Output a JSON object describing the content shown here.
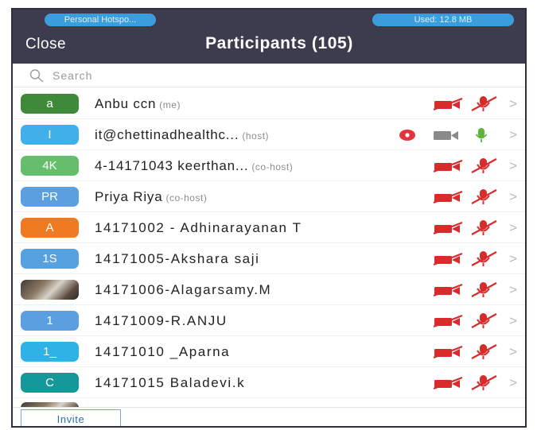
{
  "status_bar": {
    "hotspot_label": "Personal Hotspo...",
    "data_used": "Used: 12.8 MB"
  },
  "header": {
    "close_label": "Close",
    "title": "Participants (105)"
  },
  "search": {
    "placeholder": "Search"
  },
  "participants": [
    {
      "initials": "a",
      "avatar_color": "#3f8a3a",
      "name": "Anbu ccn",
      "role": "(me)",
      "video": "off",
      "mic": "muted"
    },
    {
      "initials": "I",
      "avatar_color": "#42b0e8",
      "name": "it@chettinadhealthc...",
      "role": "(host)",
      "video": "on",
      "mic": "on",
      "recording": true
    },
    {
      "initials": "4K",
      "avatar_color": "#66bd6b",
      "name": "4-14171043 keerthan...",
      "role": "(co-host)",
      "video": "off",
      "mic": "muted"
    },
    {
      "initials": "PR",
      "avatar_color": "#5b9fe0",
      "name": "Priya Riya",
      "role": "(co-host)",
      "video": "off",
      "mic": "muted"
    },
    {
      "initials": "A",
      "avatar_color": "#f07a22",
      "name": "14171002 - Adhinarayanan T",
      "role": "",
      "video": "off",
      "mic": "muted"
    },
    {
      "initials": "1S",
      "avatar_color": "#56a2e0",
      "name": "14171005-Akshara saji",
      "role": "",
      "video": "off",
      "mic": "muted"
    },
    {
      "initials": "",
      "avatar_color": "photo",
      "name": "14171006-Alagarsamy.M",
      "role": "",
      "video": "off",
      "mic": "muted"
    },
    {
      "initials": "1",
      "avatar_color": "#5c9fe0",
      "name": "14171009-R.ANJU",
      "role": "",
      "video": "off",
      "mic": "muted"
    },
    {
      "initials": "1_",
      "avatar_color": "#2fb3e6",
      "name": "14171010 _Aparna",
      "role": "",
      "video": "off",
      "mic": "muted"
    },
    {
      "initials": "C",
      "avatar_color": "#14989a",
      "name": "14171015 Baladevi.k",
      "role": "",
      "video": "off",
      "mic": "muted"
    }
  ],
  "footer": {
    "invite_label": "Invite"
  },
  "colors": {
    "header_bg": "#3c3c4e",
    "pill_blue": "#3a9edc",
    "muted_red": "#d82b2b",
    "mic_on_green": "#5cb53a",
    "video_on_gray": "#8a8a8a",
    "record_red": "#e2363d"
  }
}
